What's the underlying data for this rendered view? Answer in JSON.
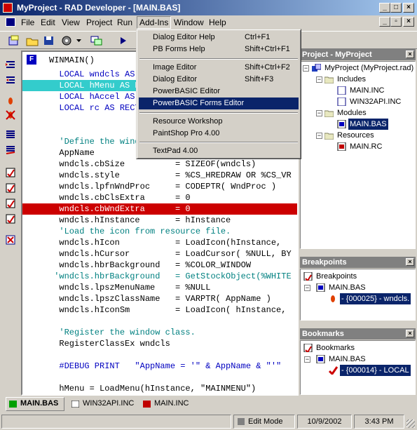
{
  "window": {
    "title": "MyProject - RAD Developer - [MAIN.BAS]"
  },
  "menubar": {
    "items": [
      "File",
      "Edit",
      "View",
      "Project",
      "Run",
      "Add-Ins",
      "Window",
      "Help"
    ]
  },
  "editor": {
    "gutter_letter": "F",
    "lines": [
      "WINMAIN()",
      "  LOCAL wndcls AS W",
      "  LOCAL hMenu AS D",
      "  LOCAL hAccel AS ",
      "  LOCAL rc AS RECT",
      "",
      "",
      "  'Define the windo",
      "  AppName",
      "  wndcls.cbSize          = SIZEOF(wndcls)",
      "  wndcls.style           = %CS_HREDRAW OR %CS_VR",
      "  wndcls.lpfnWndProc     = CODEPTR( WndProc )",
      "  wndcls.cbClsExtra      = 0",
      "  wndcls.cbWndExtra      = 0",
      "  wndcls.hInstance       = hInstance",
      "  'Load the icon from resource file.",
      "  wndcls.hIcon           = LoadIcon(hInstance, ",
      "  wndcls.hCursor         = LoadCursor( %NULL, BY",
      "  wndcls.hbrBackground   = %COLOR_WINDOW",
      " 'wndcls.hbrBackground   = GetStockObject(%WHITE",
      "  wndcls.lpszMenuName    = %NULL",
      "  wndcls.lpszClassName   = VARPTR( AppName )",
      "  wndcls.hIconSm         = LoadIcon( hInstance, ",
      "",
      "  'Register the window class.",
      "  RegisterClassEx wndcls",
      "",
      "  #DEBUG PRINT   \"AppName = '\" & AppName & \"'\"",
      "",
      "  hMenu = LoadMenu(hInstance, \"MAINMENU\")"
    ]
  },
  "addins_menu": {
    "items": [
      {
        "label": "Dialog Editor Help",
        "shortcut": "Ctrl+F1"
      },
      {
        "label": "PB Forms Help",
        "shortcut": "Shift+Ctrl+F1"
      },
      {
        "label": "Image Editor",
        "shortcut": "Shift+Ctrl+F2"
      },
      {
        "label": "Dialog Editor",
        "shortcut": "Shift+F3"
      },
      {
        "label": "PowerBASIC Editor",
        "shortcut": ""
      },
      {
        "label": "PowerBASIC Forms Editor",
        "shortcut": ""
      },
      {
        "label": "Resource Workshop",
        "shortcut": ""
      },
      {
        "label": "PaintShop Pro 4.00",
        "shortcut": ""
      },
      {
        "label": "TextPad 4.00",
        "shortcut": ""
      }
    ]
  },
  "project_panel": {
    "title": "Project - MyProject",
    "root": "MyProject (MyProject.rad)",
    "includes_label": "Includes",
    "includes": [
      "MAIN.INC",
      "WIN32API.INC"
    ],
    "modules_label": "Modules",
    "modules": [
      "MAIN.BAS"
    ],
    "resources_label": "Resources",
    "resources": [
      "MAIN.RC"
    ]
  },
  "breakpoints_panel": {
    "title": "Breakpoints",
    "root": "Breakpoints",
    "file": "MAIN.BAS",
    "entry": "- {000025} - wndcls."
  },
  "bookmarks_panel": {
    "title": "Bookmarks",
    "root": "Bookmarks",
    "file": "MAIN.BAS",
    "entry": "- {000014} - LOCAL"
  },
  "tabs": [
    "MAIN.BAS",
    "WIN32API.INC",
    "MAIN.INC"
  ],
  "status": {
    "mode": "Edit Mode",
    "date": "10/9/2002",
    "time": "3:43 PM"
  },
  "colors": {
    "title_gradient_start": "#0a246a",
    "selection": "#0a246a",
    "cyan_highlight": "#33cccc",
    "breakpoint_red": "#cc0000"
  }
}
